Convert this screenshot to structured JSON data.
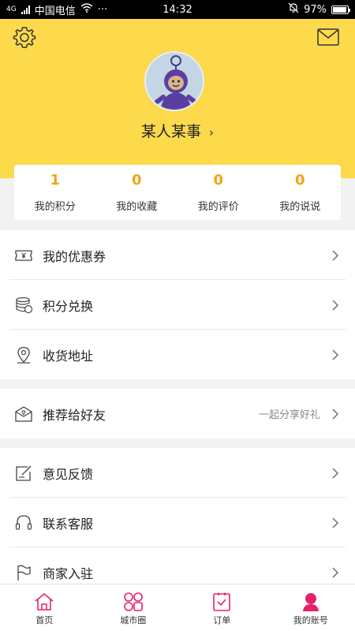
{
  "status_bar": {
    "network": "4G",
    "carrier": "中国电信",
    "more": "···",
    "time": "14:32",
    "battery": "97%",
    "battery_level": 0.97
  },
  "header": {
    "username": "某人某事",
    "chevron": "›",
    "settings_icon": "gear-icon",
    "mail_icon": "mail-icon"
  },
  "stats": [
    {
      "value": "1",
      "label": "我的积分"
    },
    {
      "value": "0",
      "label": "我的收藏"
    },
    {
      "value": "0",
      "label": "我的评价"
    },
    {
      "value": "0",
      "label": "我的说说"
    }
  ],
  "menu": {
    "group1": [
      {
        "label": "我的优惠券",
        "icon": "coupon-icon"
      },
      {
        "label": "积分兑换",
        "icon": "coins-icon"
      },
      {
        "label": "收货地址",
        "icon": "location-icon"
      }
    ],
    "group2": [
      {
        "label": "推荐给好友",
        "icon": "gift-icon",
        "hint": "一起分享好礼"
      }
    ],
    "group3": [
      {
        "label": "意见反馈",
        "icon": "feedback-icon"
      },
      {
        "label": "联系客服",
        "icon": "headset-icon"
      },
      {
        "label": "商家入驻",
        "icon": "flag-icon"
      }
    ]
  },
  "tabbar": [
    {
      "label": "首页",
      "icon": "home-icon"
    },
    {
      "label": "城市圈",
      "icon": "grid-icon"
    },
    {
      "label": "订单",
      "icon": "order-icon"
    },
    {
      "label": "我的账号",
      "icon": "account-icon",
      "active": true
    }
  ],
  "colors": {
    "header_bg": "#fdd94c",
    "stat_number": "#f2a516",
    "tab_accent": "#e6206b"
  }
}
